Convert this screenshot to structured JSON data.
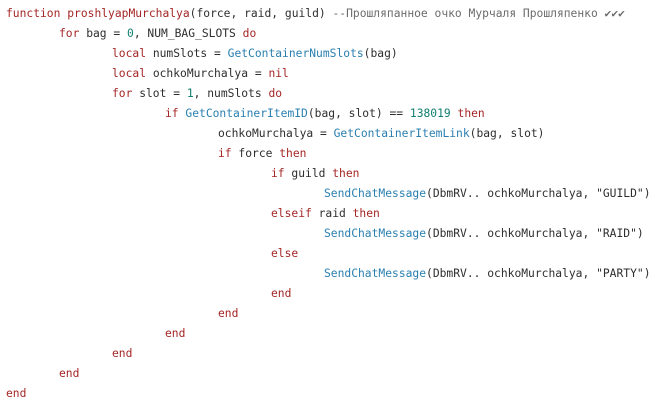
{
  "code": {
    "lines": [
      {
        "indent": 0,
        "tokens": [
          {
            "t": "function",
            "c": "kw"
          },
          {
            "t": " ",
            "c": "tx"
          },
          {
            "t": "proshlyapMurchalya",
            "c": "kw"
          },
          {
            "t": "(force, raid, guild) ",
            "c": "tx"
          },
          {
            "t": "--Прошляпанное очко Мурчаля Прошляпенко ✔✔✔",
            "c": "cmt"
          }
        ]
      },
      {
        "indent": 1,
        "tokens": [
          {
            "t": "for",
            "c": "kw"
          },
          {
            "t": " bag = ",
            "c": "tx"
          },
          {
            "t": "0",
            "c": "num"
          },
          {
            "t": ", NUM_BAG_SLOTS ",
            "c": "tx"
          },
          {
            "t": "do",
            "c": "kw"
          }
        ]
      },
      {
        "indent": 2,
        "tokens": [
          {
            "t": "local",
            "c": "kw"
          },
          {
            "t": " numSlots = ",
            "c": "tx"
          },
          {
            "t": "GetContainerNumSlots",
            "c": "fn"
          },
          {
            "t": "(bag)",
            "c": "tx"
          }
        ]
      },
      {
        "indent": 2,
        "tokens": [
          {
            "t": "local",
            "c": "kw"
          },
          {
            "t": " ochkoMurchalya = ",
            "c": "tx"
          },
          {
            "t": "nil",
            "c": "kw"
          }
        ]
      },
      {
        "indent": 2,
        "tokens": [
          {
            "t": "for",
            "c": "kw"
          },
          {
            "t": " slot = ",
            "c": "tx"
          },
          {
            "t": "1",
            "c": "num"
          },
          {
            "t": ", numSlots ",
            "c": "tx"
          },
          {
            "t": "do",
            "c": "kw"
          }
        ]
      },
      {
        "indent": 3,
        "tokens": [
          {
            "t": "if",
            "c": "kw"
          },
          {
            "t": " ",
            "c": "tx"
          },
          {
            "t": "GetContainerItemID",
            "c": "fn"
          },
          {
            "t": "(bag, slot) == ",
            "c": "tx"
          },
          {
            "t": "138019",
            "c": "num"
          },
          {
            "t": " ",
            "c": "tx"
          },
          {
            "t": "then",
            "c": "kw"
          }
        ]
      },
      {
        "indent": 4,
        "tokens": [
          {
            "t": "ochkoMurchalya = ",
            "c": "tx"
          },
          {
            "t": "GetContainerItemLink",
            "c": "fn"
          },
          {
            "t": "(bag, slot)",
            "c": "tx"
          }
        ]
      },
      {
        "indent": 4,
        "tokens": [
          {
            "t": "if",
            "c": "kw"
          },
          {
            "t": " force ",
            "c": "tx"
          },
          {
            "t": "then",
            "c": "kw"
          }
        ]
      },
      {
        "indent": 5,
        "tokens": [
          {
            "t": "if",
            "c": "kw"
          },
          {
            "t": " guild ",
            "c": "tx"
          },
          {
            "t": "then",
            "c": "kw"
          }
        ]
      },
      {
        "indent": 6,
        "tokens": [
          {
            "t": "SendChatMessage",
            "c": "fn"
          },
          {
            "t": "(DbmRV.. ochkoMurchalya, ",
            "c": "tx"
          },
          {
            "t": "\"GUILD\"",
            "c": "str"
          },
          {
            "t": ")",
            "c": "tx"
          }
        ]
      },
      {
        "indent": 5,
        "tokens": [
          {
            "t": "elseif",
            "c": "kw"
          },
          {
            "t": " raid ",
            "c": "tx"
          },
          {
            "t": "then",
            "c": "kw"
          }
        ]
      },
      {
        "indent": 6,
        "tokens": [
          {
            "t": "SendChatMessage",
            "c": "fn"
          },
          {
            "t": "(DbmRV.. ochkoMurchalya, ",
            "c": "tx"
          },
          {
            "t": "\"RAID\"",
            "c": "str"
          },
          {
            "t": ")",
            "c": "tx"
          }
        ]
      },
      {
        "indent": 5,
        "tokens": [
          {
            "t": "else",
            "c": "kw"
          }
        ]
      },
      {
        "indent": 6,
        "tokens": [
          {
            "t": "SendChatMessage",
            "c": "fn"
          },
          {
            "t": "(DbmRV.. ochkoMurchalya, ",
            "c": "tx"
          },
          {
            "t": "\"PARTY\"",
            "c": "str"
          },
          {
            "t": ")",
            "c": "tx"
          }
        ]
      },
      {
        "indent": 5,
        "tokens": [
          {
            "t": "end",
            "c": "kw"
          }
        ]
      },
      {
        "indent": 4,
        "tokens": [
          {
            "t": "end",
            "c": "kw"
          }
        ]
      },
      {
        "indent": 3,
        "tokens": [
          {
            "t": "end",
            "c": "kw"
          }
        ]
      },
      {
        "indent": 2,
        "tokens": [
          {
            "t": "end",
            "c": "kw"
          }
        ]
      },
      {
        "indent": 1,
        "tokens": [
          {
            "t": "end",
            "c": "kw"
          }
        ]
      },
      {
        "indent": 0,
        "tokens": [
          {
            "t": "end",
            "c": "kw"
          }
        ]
      }
    ]
  }
}
